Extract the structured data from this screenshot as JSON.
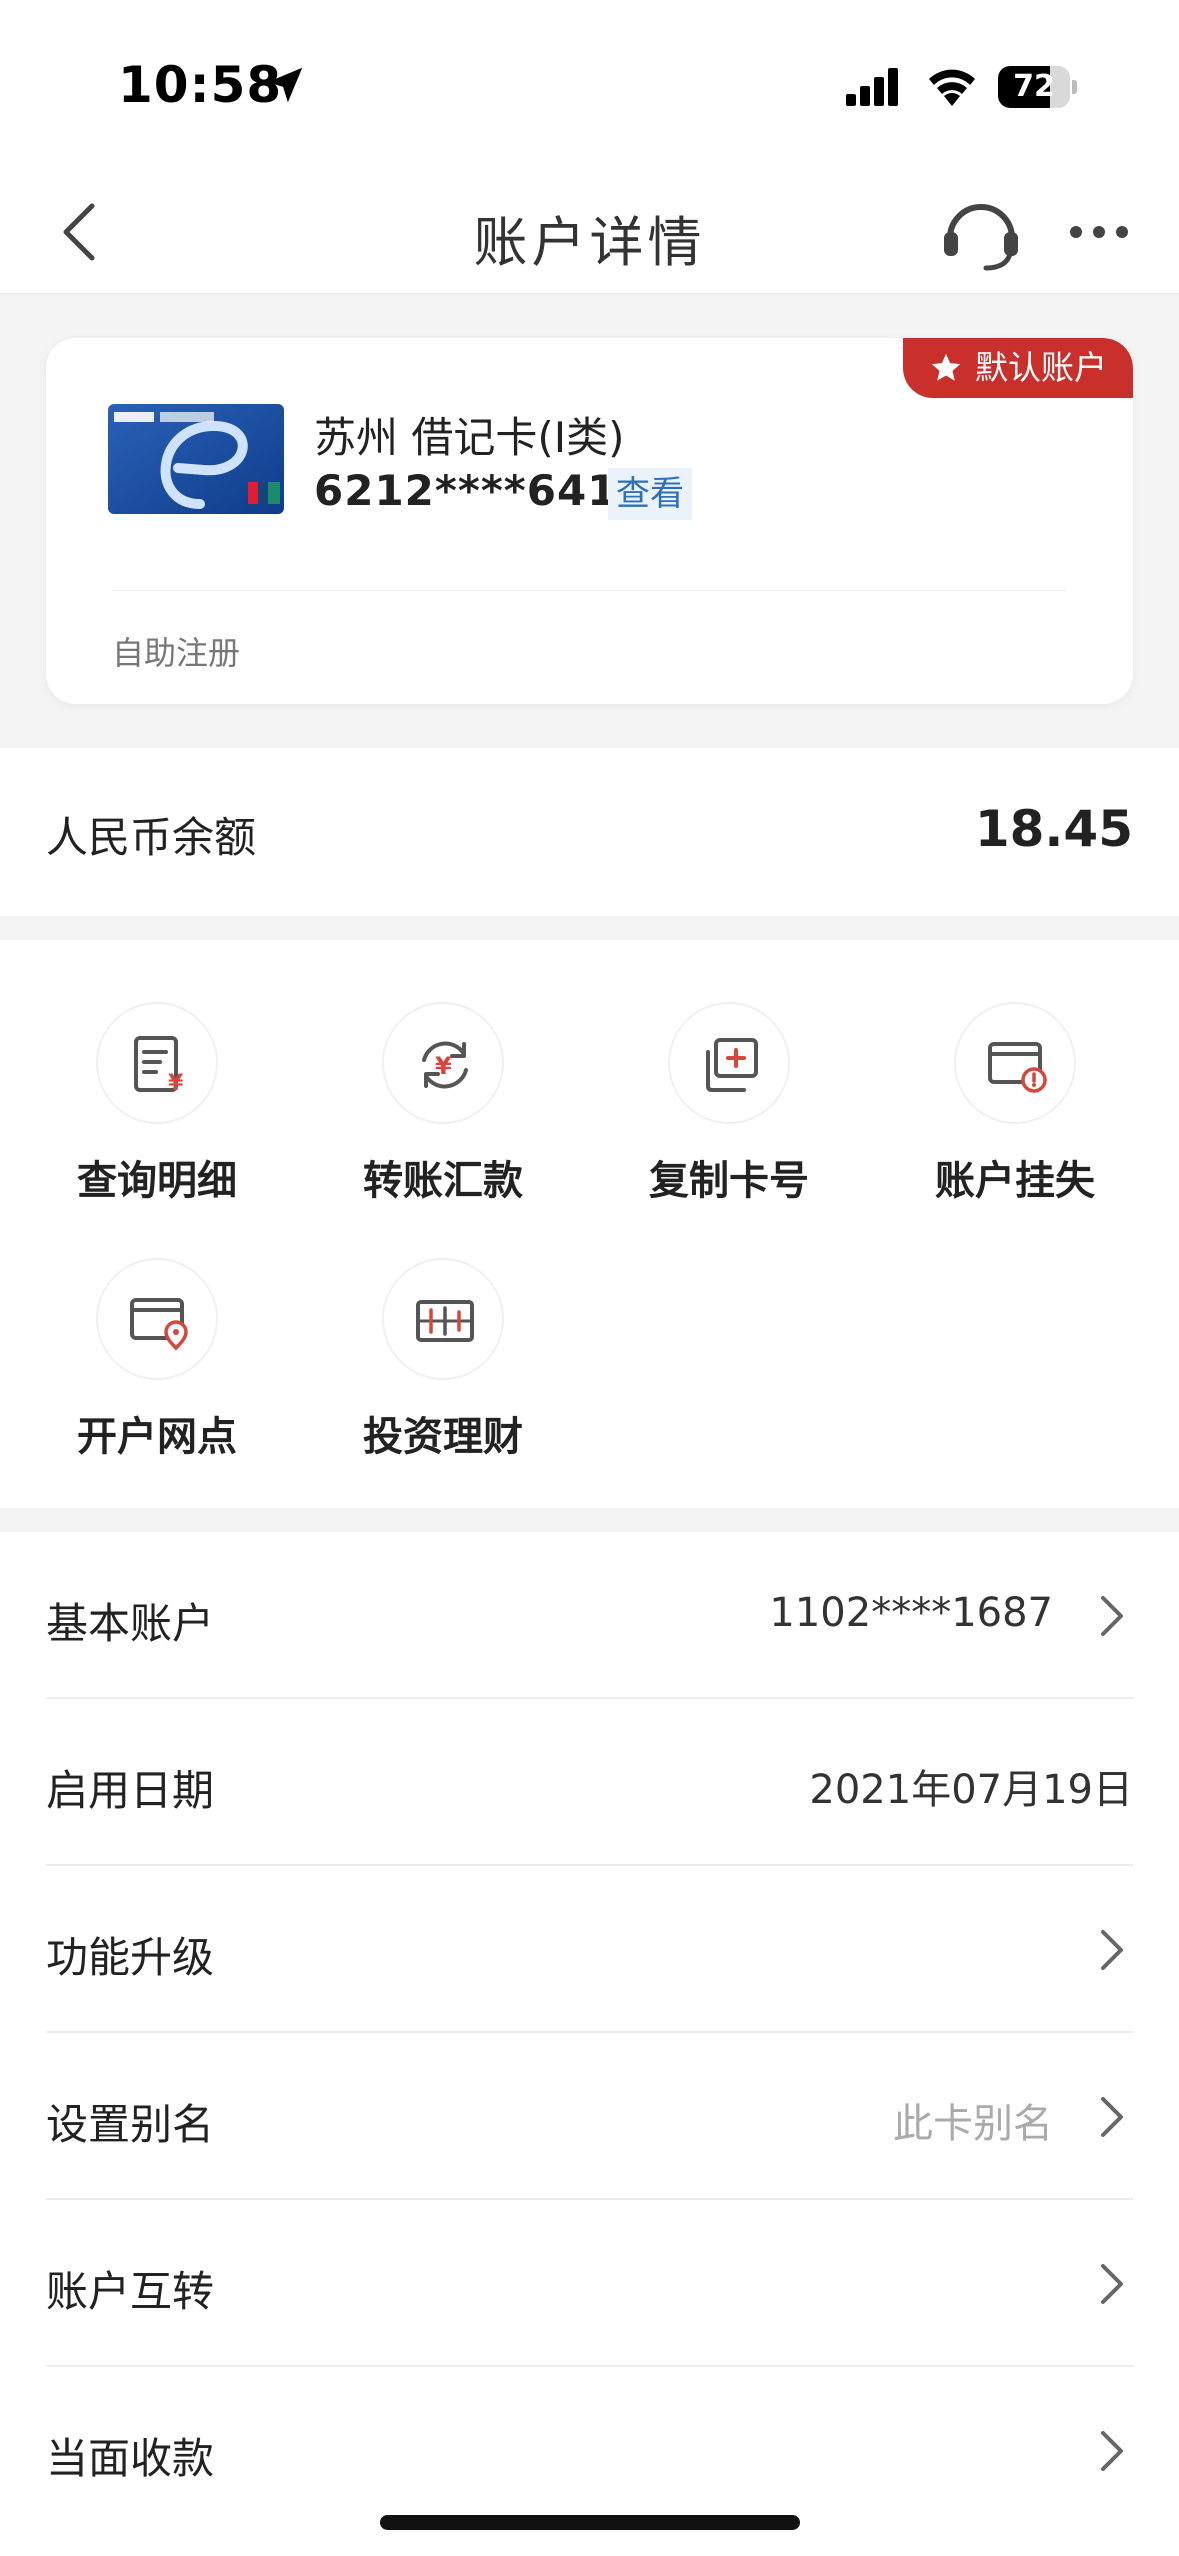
{
  "status_bar": {
    "time": "10:58",
    "battery": "72",
    "battery_level": 0.72
  },
  "nav": {
    "title": "账户详情",
    "back_icon": "chevron-left-icon",
    "service_icon": "headset-icon",
    "more_icon": "more-dots-icon"
  },
  "card": {
    "badge": "默认账户",
    "name": "苏州 借记卡(Ⅰ类)",
    "number": "6212****6419",
    "view_label": "查看",
    "footer": "自助注册"
  },
  "balance": {
    "label": "人民币余额",
    "value": "18.45"
  },
  "functions": [
    {
      "label": "查询明细",
      "icon": "statement-icon"
    },
    {
      "label": "转账汇款",
      "icon": "transfer-icon"
    },
    {
      "label": "复制卡号",
      "icon": "copy-card-icon"
    },
    {
      "label": "账户挂失",
      "icon": "report-loss-icon"
    },
    {
      "label": "开户网点",
      "icon": "branch-location-icon"
    },
    {
      "label": "投资理财",
      "icon": "investment-icon"
    }
  ],
  "list": [
    {
      "label": "基本账户",
      "value": "1102****1687"
    },
    {
      "label": "启用日期",
      "value": "2021年07月19日"
    },
    {
      "label": "功能升级",
      "value": ""
    },
    {
      "label": "设置别名",
      "value": "此卡别名"
    },
    {
      "label": "账户互转",
      "value": ""
    },
    {
      "label": "当面收款",
      "value": ""
    }
  ],
  "colors": {
    "accent_red": "#c9302c",
    "link_blue": "#2e6fb8",
    "icon_red": "#d9453d"
  }
}
